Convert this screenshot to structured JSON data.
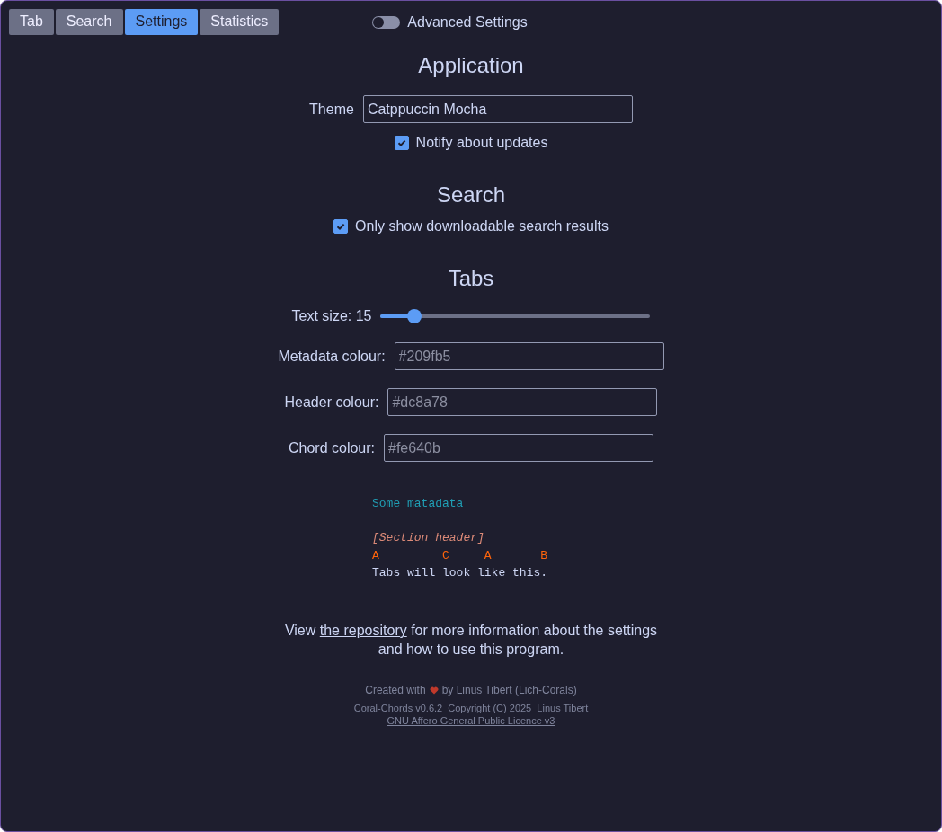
{
  "tabs": [
    {
      "label": "Tab",
      "selected": false
    },
    {
      "label": "Search",
      "selected": false
    },
    {
      "label": "Settings",
      "selected": true
    },
    {
      "label": "Statistics",
      "selected": false
    }
  ],
  "advanced_toggle": {
    "label": "Advanced Settings",
    "on": false
  },
  "sections": [
    {
      "title": "Application",
      "items": [
        {
          "kind": "text",
          "label": "Theme",
          "value": "Catppuccin Mocha"
        },
        {
          "kind": "checkbox",
          "label": "Notify about updates",
          "checked": true
        }
      ]
    },
    {
      "title": "Search",
      "items": [
        {
          "kind": "checkbox",
          "label": "Only show downloadable search results",
          "checked": true
        }
      ]
    },
    {
      "title": "Tabs",
      "items": [
        {
          "kind": "slider",
          "label": "Text size: 15",
          "level": 0.125
        },
        {
          "kind": "color",
          "label": "Metadata colour:",
          "placeholder": "#209fb5"
        },
        {
          "kind": "color",
          "label": "Header colour:",
          "placeholder": "#dc8a78"
        },
        {
          "kind": "color",
          "label": "Chord colour:",
          "placeholder": "#fe640b"
        }
      ]
    }
  ],
  "preview": [
    {
      "kind": "metadata",
      "text": "Some matadata"
    },
    {
      "kind": "blank"
    },
    {
      "kind": "header",
      "text": "[Section header]"
    },
    {
      "kind": "chords",
      "text": "A         C     A       B"
    },
    {
      "kind": "lyrics",
      "text": "Tabs will look like this."
    }
  ],
  "info": {
    "before": "View",
    "link": "the repository",
    "after": "for more information about the settings and how to use this program."
  },
  "footer": {
    "created_before": "Created with",
    "created_after": "by Linus Tibert (Lich-Corals)",
    "copyright": "Coral-Chords v0.6.2  Copyright (C) 2025  Linus Tibert",
    "licence": "GNU Affero General Public Licence v3"
  }
}
